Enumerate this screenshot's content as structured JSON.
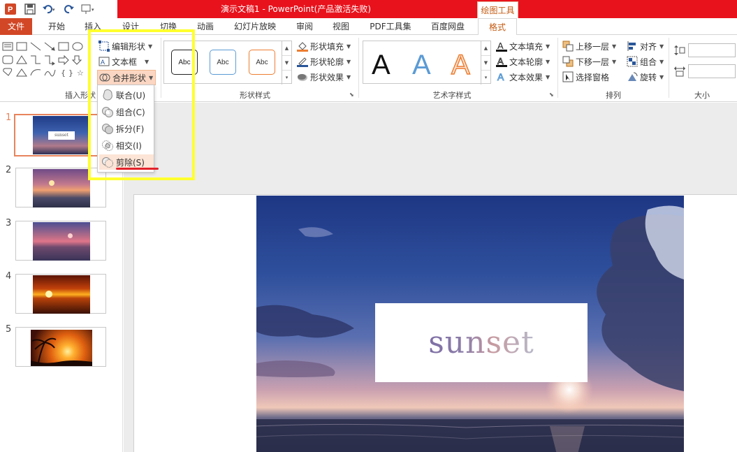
{
  "title_bar": {
    "doc_title": "演示文稿1 - PowerPoint(产品激活失败)",
    "context_tab": "绘图工具"
  },
  "tabs": [
    "文件",
    "开始",
    "插入",
    "设计",
    "切换",
    "动画",
    "幻灯片放映",
    "审阅",
    "视图",
    "PDF工具集",
    "百度网盘",
    "格式"
  ],
  "active_tab": "格式",
  "ribbon": {
    "insert_shapes": {
      "label": "插入形状",
      "edit_shape": "编辑形状",
      "text_box": "文本框",
      "merge_shapes": "合并形状"
    },
    "shape_styles": {
      "label": "形状样式",
      "samples": [
        "Abc",
        "Abc",
        "Abc"
      ],
      "fill": "形状填充",
      "outline": "形状轮廓",
      "effects": "形状效果"
    },
    "wordart_styles": {
      "label": "艺术字样式",
      "samples": [
        "A",
        "A",
        "A"
      ],
      "text_fill": "文本填充",
      "text_outline": "文本轮廓",
      "text_effects": "文本效果"
    },
    "arrange": {
      "label": "排列",
      "bring_forward": "上移一层",
      "send_backward": "下移一层",
      "selection_pane": "选择窗格",
      "align": "对齐",
      "group": "组合",
      "rotate": "旋转"
    },
    "size": {
      "label": "大小"
    }
  },
  "merge_menu": {
    "items": [
      "联合(U)",
      "组合(C)",
      "拆分(F)",
      "相交(I)",
      "剪除(S)"
    ],
    "highlighted": "剪除(S)"
  },
  "thumbnails": {
    "numbers": [
      "1",
      "2",
      "3",
      "4",
      "5"
    ],
    "selected": "1",
    "slide1_text": "sunset"
  },
  "slide": {
    "text": "sunset"
  },
  "colors": {
    "title_red": "#e8121c",
    "file_tab": "#d24726",
    "accent_orange": "#c45a11",
    "annotation_yellow": "#ffff2e",
    "annotation_red": "#e3212b"
  }
}
